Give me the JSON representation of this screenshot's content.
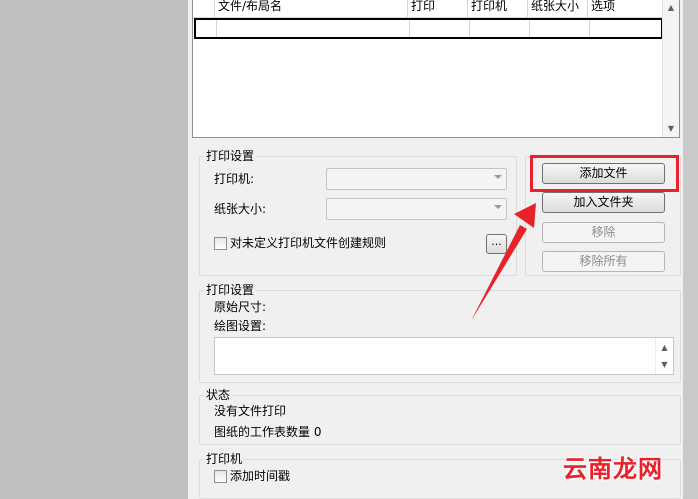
{
  "list": {
    "columns": [
      "文件/布局名",
      "打印",
      "打印机",
      "纸张大小",
      "选项"
    ]
  },
  "print_settings": {
    "title": "打印设置",
    "printer_label": "打印机:",
    "paper_label": "纸张大小:",
    "printer_value": "",
    "paper_value": "",
    "rule_checkbox_label": "对未定义打印机文件创建规则",
    "rule_checked": false,
    "browse_label": "..."
  },
  "buttons": {
    "add_file": "添加文件",
    "add_folder": "加入文件夹",
    "remove": "移除",
    "remove_all": "移除所有"
  },
  "print_info": {
    "title": "打印设置",
    "original_size_label": "原始尺寸:",
    "plot_settings_label": "绘图设置:"
  },
  "status": {
    "title": "状态",
    "no_files": "没有文件打印",
    "sheet_count_label": "图纸的工作表数量",
    "sheet_count_value": "0"
  },
  "printer_group": {
    "title": "打印机",
    "timestamp_label": "添加时间戳",
    "timestamp_checked": false
  },
  "annotation": {
    "highlight_color": "#e8212a",
    "arrow_color": "#e8212a"
  },
  "watermark": {
    "text": "云南龙网"
  }
}
